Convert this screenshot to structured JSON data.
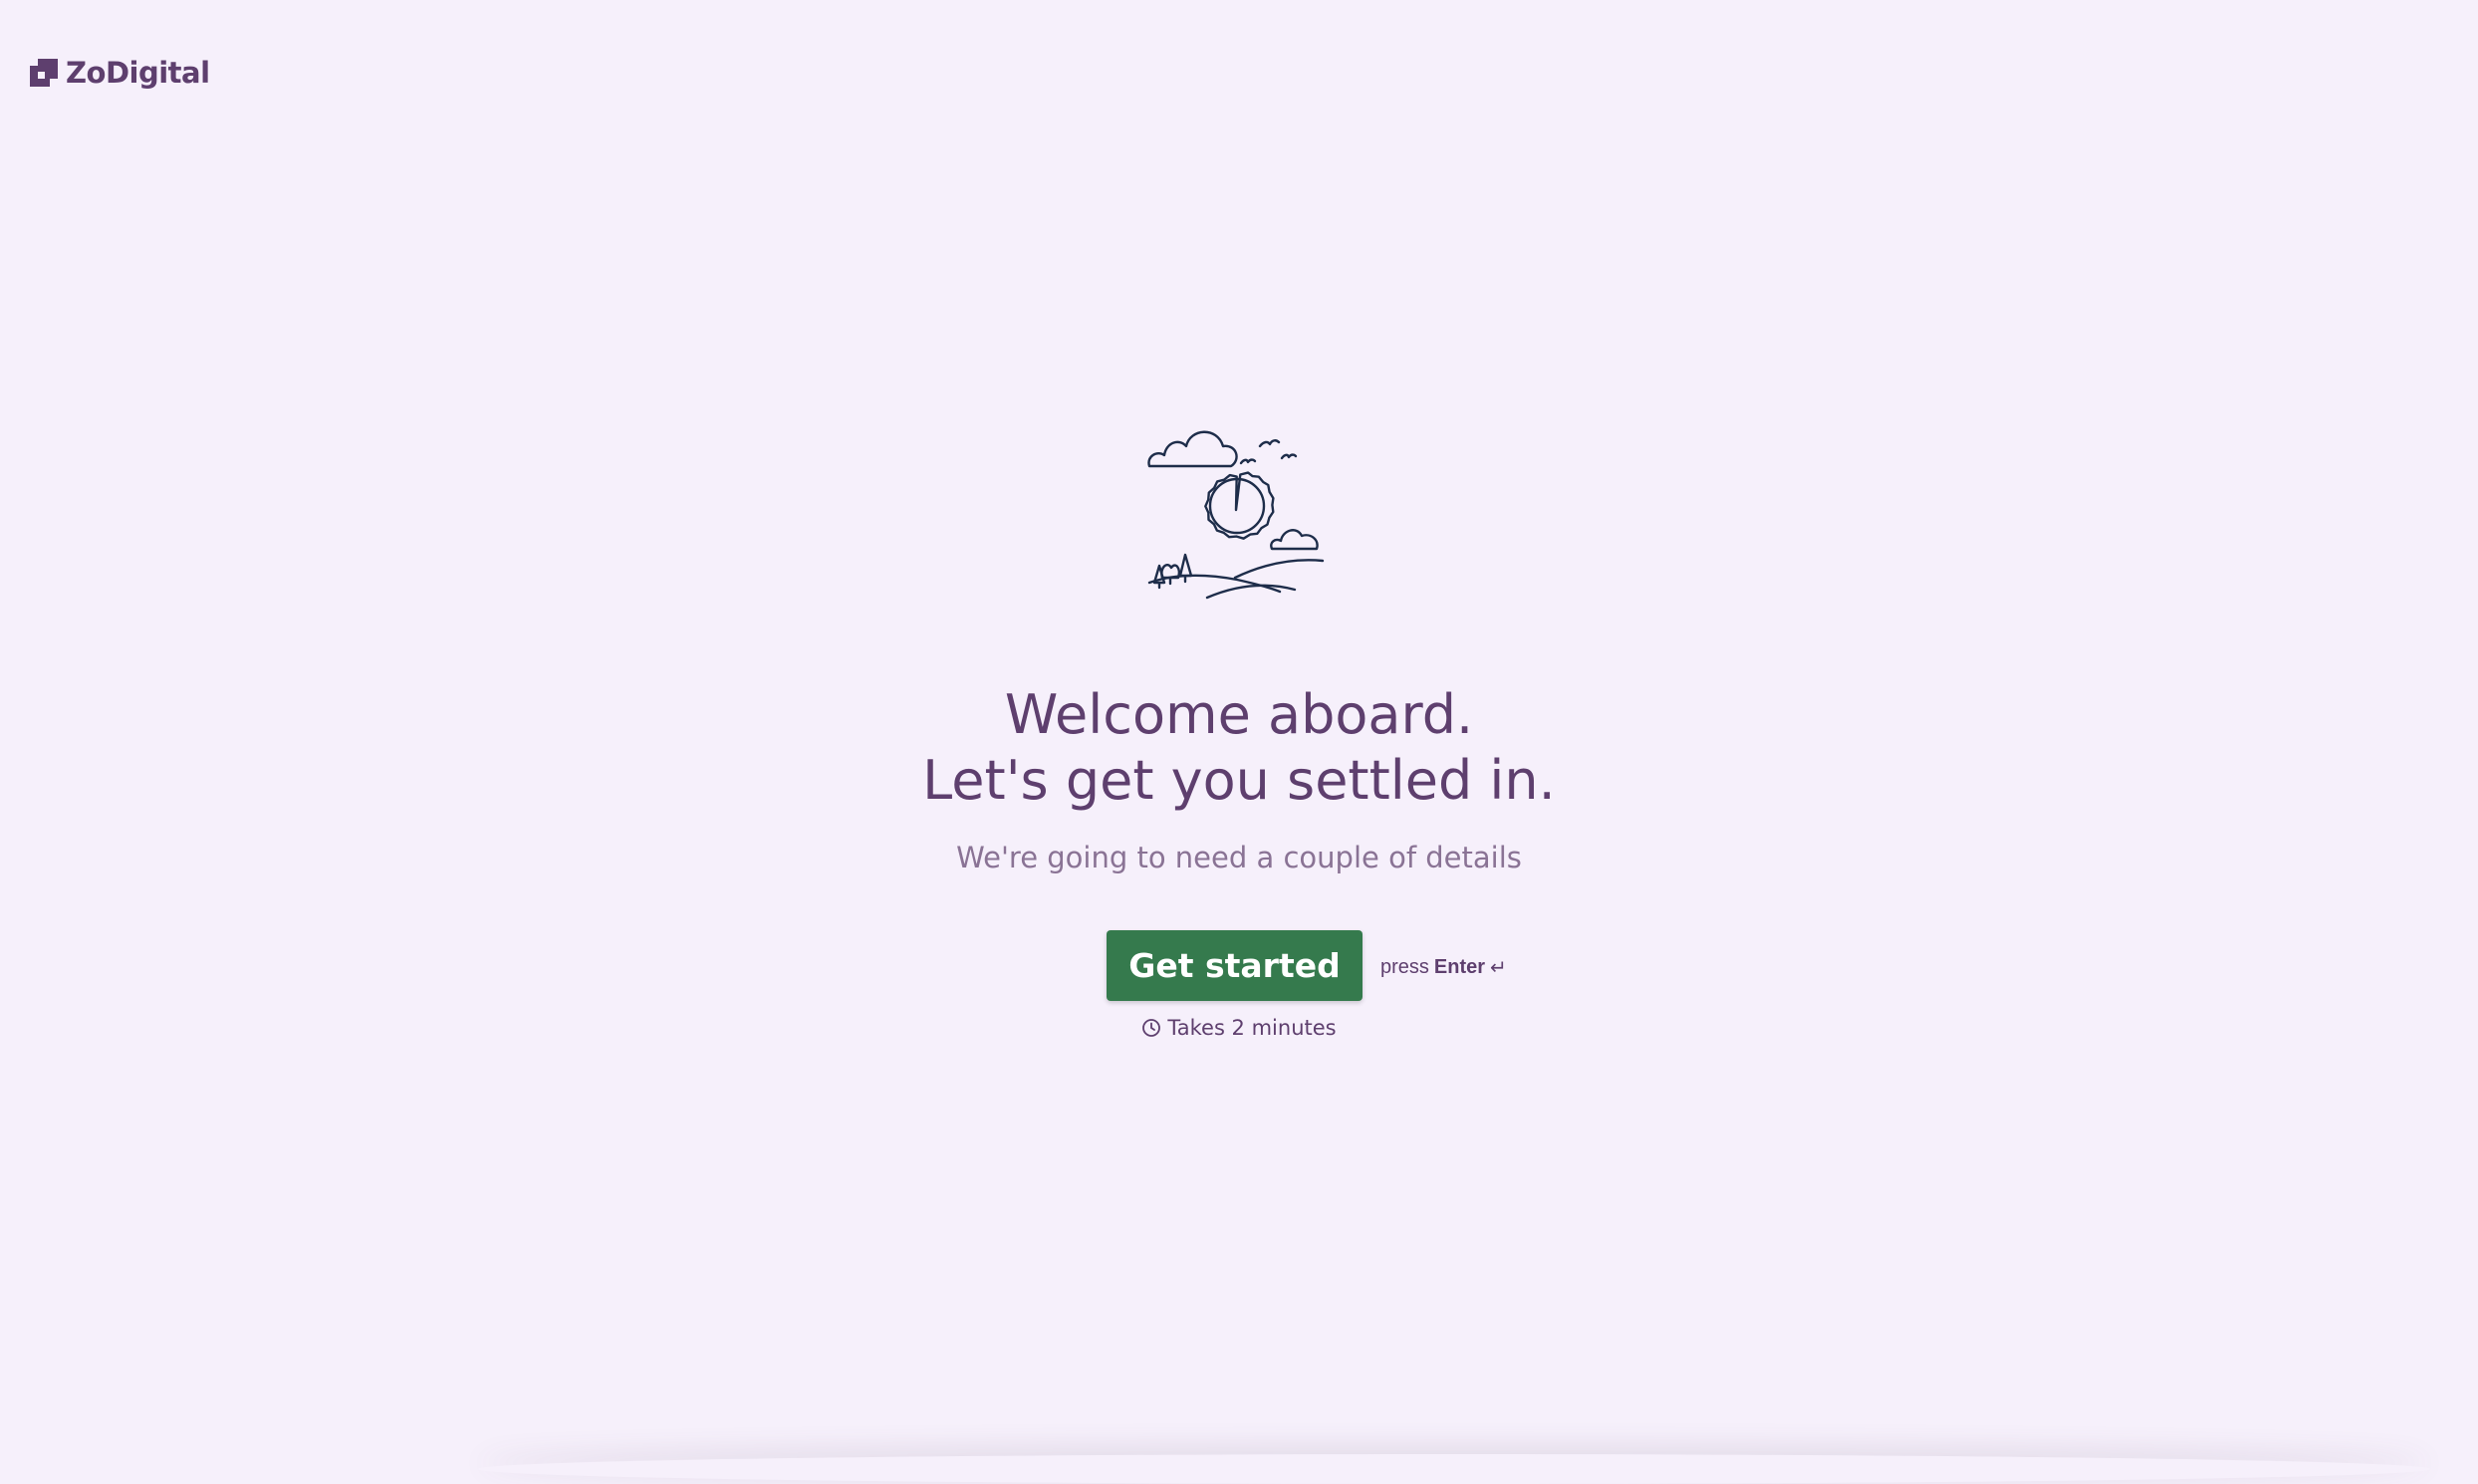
{
  "brand": {
    "logo_text": "ZoDigital",
    "primary_color": "#5e3f6e",
    "background_color": "#f6f0fb"
  },
  "illustration": {
    "icon": "sun-landscape-illustration",
    "stroke_color": "#1e2d4a"
  },
  "welcome": {
    "line1": "Welcome aboard.",
    "line2": "Let's get you settled in.",
    "subtitle": "We're going to need a couple of details"
  },
  "cta": {
    "button_label": "Get started",
    "button_color": "#357a4d",
    "press_label": "press",
    "key_label": "Enter",
    "enter_icon": "↵",
    "duration_text": "Takes 2 minutes"
  }
}
